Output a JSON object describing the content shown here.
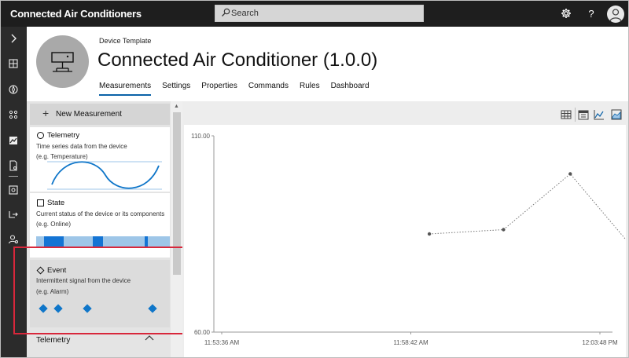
{
  "app": {
    "title": "Connected Air Conditioners"
  },
  "search": {
    "placeholder": "Search"
  },
  "topbar": {
    "settings_icon": "gear-icon",
    "help_label": "?",
    "avatar_icon": "user-icon"
  },
  "rail": {
    "items": [
      "chevron-right-icon",
      "dashboard-icon",
      "explorer-icon",
      "devices-icon",
      "analytics-icon",
      "device-template-icon",
      "jobs-icon",
      "export-icon",
      "administration-icon"
    ]
  },
  "header": {
    "subtitle": "Device Template",
    "title": "Connected Air Conditioner (1.0.0)",
    "tabs": [
      "Measurements",
      "Settings",
      "Properties",
      "Commands",
      "Rules",
      "Dashboard"
    ],
    "active_tab": "Measurements"
  },
  "panel": {
    "new_label": "New Measurement",
    "cards": [
      {
        "title": "Telemetry",
        "desc": "Time series data from the device",
        "example": "(e.g. Temperature)"
      },
      {
        "title": "State",
        "desc": "Current status of the device or its components",
        "example": "(e.g. Online)"
      },
      {
        "title": "Event",
        "desc": "Intermittent signal from the device",
        "example": "(e.g. Alarm)"
      }
    ],
    "lower_heading": "Telemetry"
  },
  "colors": {
    "accent": "#0a62a8",
    "highlight": "#d8273b",
    "wave": "#0f76c9",
    "state_light": "#9ec6e8",
    "state_dark": "#1474d4"
  },
  "chart_data": {
    "type": "line",
    "y_ticks": [
      "110.00",
      "60.00"
    ],
    "ylim": [
      60,
      110
    ],
    "x_ticks": [
      "11:53:36 AM",
      "11:58:42 AM",
      "12:03:48 PM"
    ],
    "x_minutes": [
      0,
      5.1,
      10.2
    ],
    "points_x": [
      5.6,
      7.6,
      9.4,
      11.2
    ],
    "points_y": [
      85.0,
      86.1,
      100.3,
      80.2
    ],
    "line_style": "dotted"
  }
}
